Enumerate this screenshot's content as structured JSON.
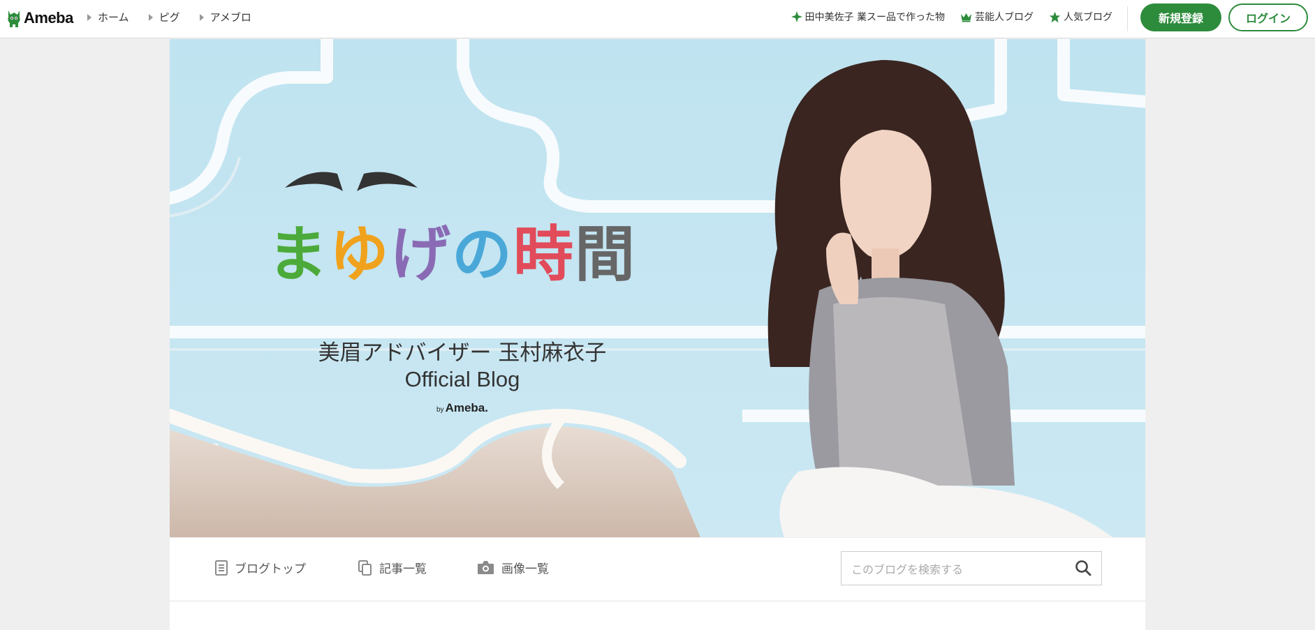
{
  "header": {
    "logo_text": "Ameba",
    "breadcrumbs": [
      "ホーム",
      "ピグ",
      "アメブロ"
    ],
    "links": [
      {
        "label": "田中美佐子 業スー品で作った物",
        "icon": "sparkle-icon"
      },
      {
        "label": "芸能人ブログ",
        "icon": "crown-icon"
      },
      {
        "label": "人気ブログ",
        "icon": "star-icon"
      }
    ],
    "register_label": "新規登録",
    "login_label": "ログイン"
  },
  "hero": {
    "title_chars": [
      "ま",
      "ゆ",
      "げ",
      "の",
      "時",
      "間"
    ],
    "subtitle": "美眉アドバイザー 玉村麻衣子",
    "blog_label": "Official Blog",
    "by_prefix": "by",
    "by_brand": "Ameba."
  },
  "blognav": {
    "items": [
      {
        "label": "ブログトップ",
        "icon": "document-icon"
      },
      {
        "label": "記事一覧",
        "icon": "copy-icon"
      },
      {
        "label": "画像一覧",
        "icon": "camera-icon"
      }
    ],
    "search_placeholder": "このブログを検索する"
  },
  "colors": {
    "brand_green": "#2d8c3c",
    "title_colors": [
      "#4caa3a",
      "#f0a21d",
      "#8a6ab5",
      "#4aa8d8",
      "#e14b5a",
      "#666666"
    ]
  }
}
